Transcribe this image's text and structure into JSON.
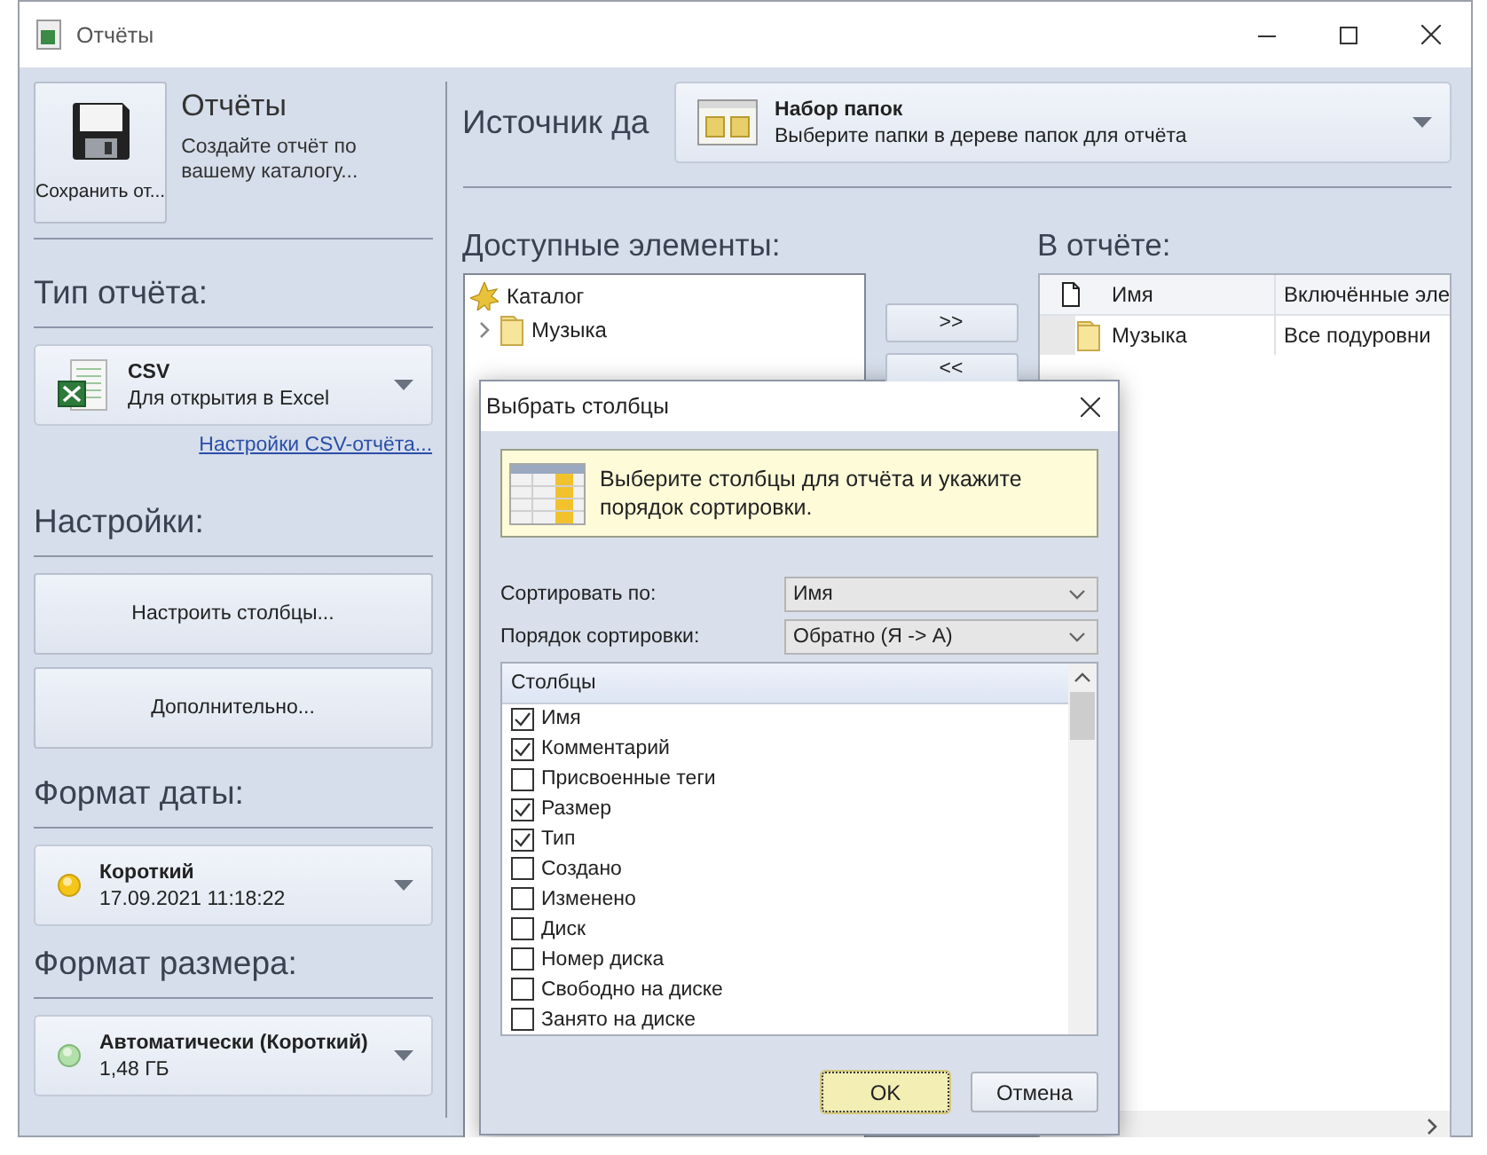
{
  "window": {
    "title": "Отчёты"
  },
  "save_button": {
    "label": "Сохранить от..."
  },
  "header": {
    "title": "Отчёты",
    "subtitle": "Создайте отчёт по вашему каталогу..."
  },
  "report_type": {
    "heading": "Тип отчёта:",
    "combo": {
      "title": "CSV",
      "subtitle": "Для открытия в Excel"
    },
    "link": "Настройки CSV-отчёта..."
  },
  "settings": {
    "heading": "Настройки:",
    "buttons": [
      "Настроить столбцы...",
      "Дополнительно..."
    ]
  },
  "date_format": {
    "heading": "Формат даты:",
    "combo": {
      "title": "Короткий",
      "subtitle": "17.09.2021 11:18:22"
    }
  },
  "size_format": {
    "heading": "Формат размера:",
    "combo": {
      "title": "Автоматически (Короткий)",
      "subtitle": "1,48 ГБ"
    }
  },
  "source": {
    "label": "Источник да",
    "combo": {
      "title": "Набор папок",
      "subtitle": "Выберите папки в дереве папок для отчёта"
    }
  },
  "available": {
    "heading": "Доступные элементы:",
    "tree": [
      {
        "label": "Каталог",
        "kind": "catalog",
        "expanded": true,
        "children": [
          {
            "label": "Музыка",
            "kind": "folder",
            "expanded": false
          }
        ]
      }
    ]
  },
  "move_buttons": [
    ">>",
    "<<"
  ],
  "in_report": {
    "heading": "В отчёте:",
    "columns": [
      "Имя",
      "Включённые эле"
    ],
    "rows": [
      {
        "cells": [
          "Музыка",
          "Все подуровни"
        ]
      }
    ]
  },
  "dialog": {
    "title": "Выбрать столбцы",
    "info": "Выберите столбцы для отчёта и укажите порядок сортировки.",
    "sort_by": {
      "label": "Сортировать по:",
      "value": "Имя"
    },
    "sort_order": {
      "label": "Порядок сортировки:",
      "value": "Обратно (Я -> А)"
    },
    "list_heading": "Столбцы",
    "items": [
      {
        "label": "Имя",
        "checked": true
      },
      {
        "label": "Комментарий",
        "checked": true
      },
      {
        "label": "Присвоенные теги",
        "checked": false
      },
      {
        "label": "Размер",
        "checked": true
      },
      {
        "label": "Тип",
        "checked": true
      },
      {
        "label": "Создано",
        "checked": false
      },
      {
        "label": "Изменено",
        "checked": false
      },
      {
        "label": "Диск",
        "checked": false
      },
      {
        "label": "Номер диска",
        "checked": false
      },
      {
        "label": "Свободно на диске",
        "checked": false
      },
      {
        "label": "Занято на диске",
        "checked": false
      }
    ],
    "buttons": [
      {
        "label": "OK",
        "kind": "default"
      },
      {
        "label": "Отмена",
        "kind": "normal"
      }
    ]
  }
}
